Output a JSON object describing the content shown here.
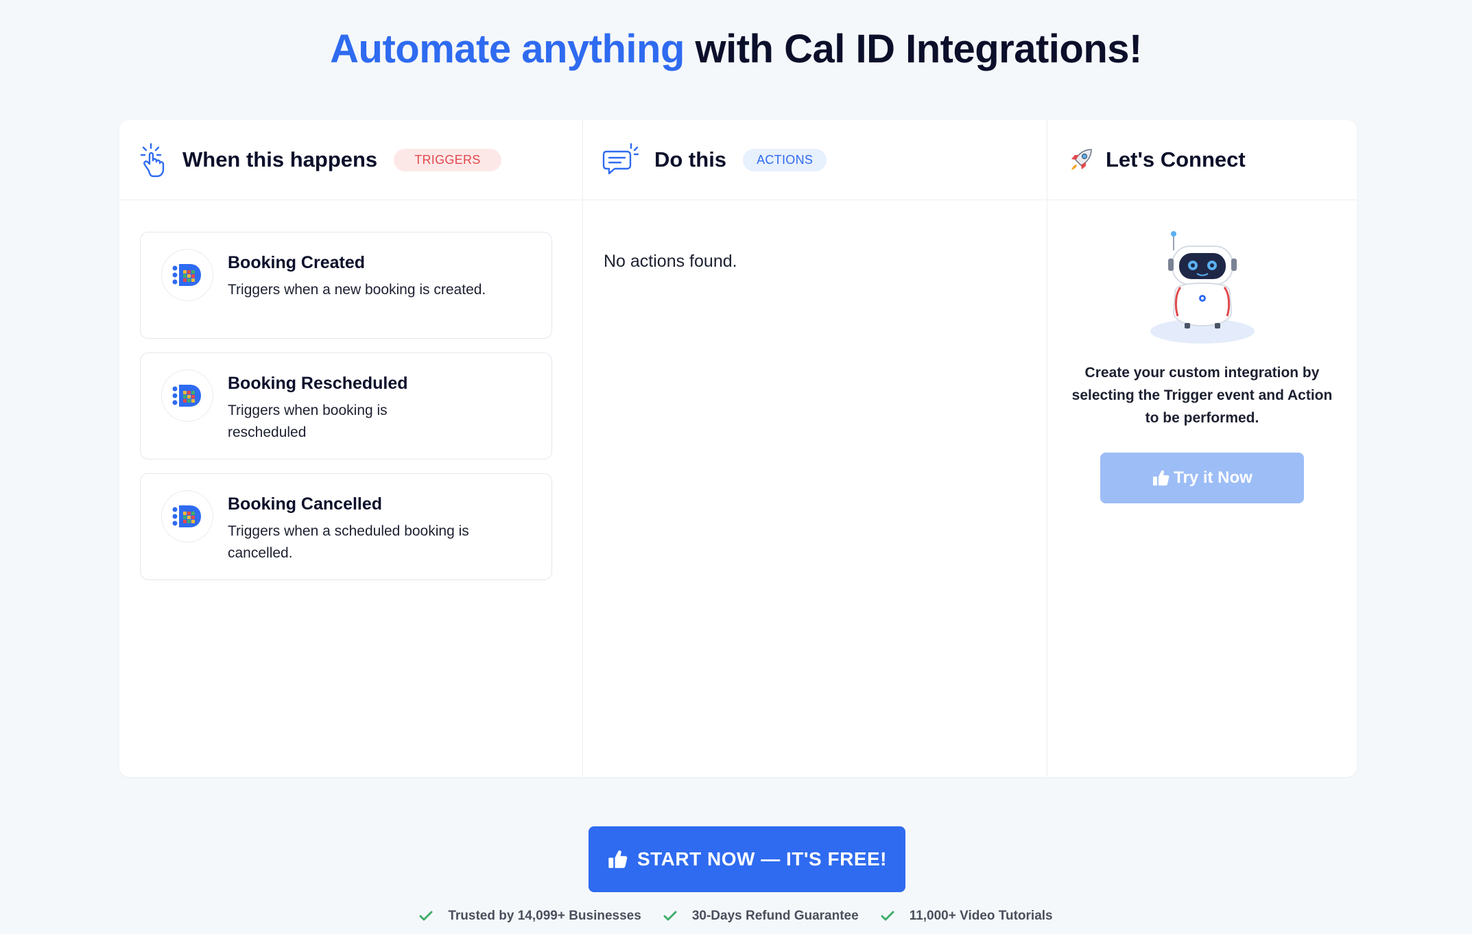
{
  "headline": {
    "accent": "Automate anything",
    "rest": "with Cal ID Integrations!"
  },
  "columns": {
    "triggers": {
      "title": "When this happens",
      "badge": "TRIGGERS",
      "icon": "tap-hand-icon",
      "items": [
        {
          "title": "Booking Created",
          "description": "Triggers when a new booking is created.",
          "icon": "cal-id-logo-icon"
        },
        {
          "title": "Booking Rescheduled",
          "description": "Triggers when booking is rescheduled",
          "icon": "cal-id-logo-icon"
        },
        {
          "title": "Booking Cancelled",
          "description": "Triggers when a scheduled booking is cancelled.",
          "icon": "cal-id-logo-icon"
        }
      ]
    },
    "actions": {
      "title": "Do this",
      "badge": "ACTIONS",
      "icon": "chat-bubble-icon",
      "empty_text": "No actions found."
    },
    "connect": {
      "title": "Let's Connect",
      "icon": "rocket-icon",
      "illustration": "robot-icon",
      "description": "Create your custom integration by selecting the Trigger event and Action to be performed.",
      "button_label": "Try it Now",
      "button_icon": "thumbs-up-icon"
    }
  },
  "cta": {
    "label": "START NOW — IT'S FREE!",
    "icon": "thumbs-up-icon"
  },
  "trust_badges": [
    "Trusted by 14,099+ Businesses",
    "30-Days Refund Guarantee",
    "11,000+ Video Tutorials"
  ],
  "colors": {
    "accent": "#2f6bf0",
    "triggers_badge_bg": "#fde8e8",
    "triggers_badge_text": "#e2494c",
    "actions_badge_bg": "#e7f0fd",
    "disabled_button": "#9dbdf6",
    "check": "#3fae6a",
    "page_bg": "#f5f8fb"
  }
}
